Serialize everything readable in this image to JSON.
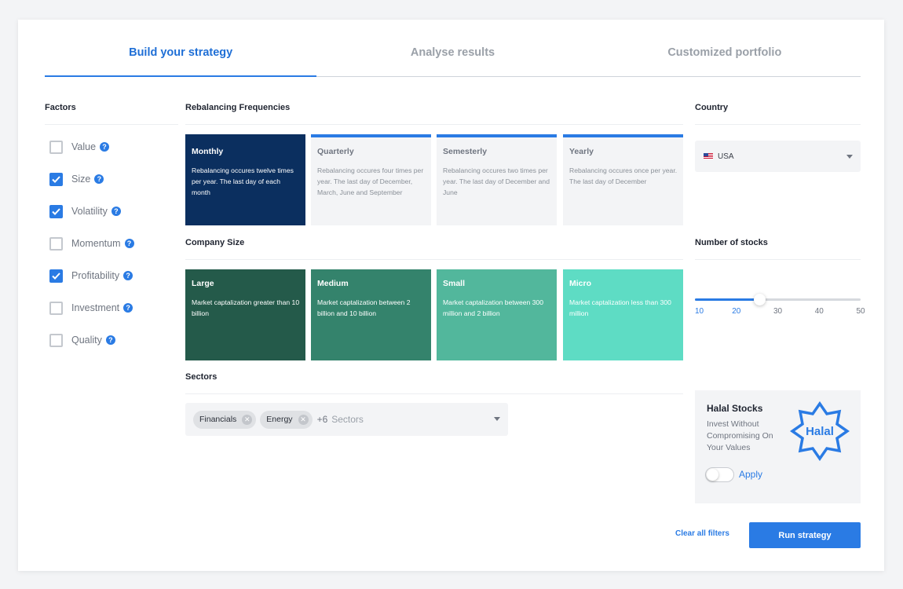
{
  "tabs": [
    {
      "label": "Build your strategy",
      "active": true
    },
    {
      "label": "Analyse results",
      "active": false
    },
    {
      "label": "Customized portfolio",
      "active": false
    }
  ],
  "factors": {
    "title": "Factors",
    "items": [
      {
        "label": "Value",
        "checked": false
      },
      {
        "label": "Size",
        "checked": true
      },
      {
        "label": "Volatility",
        "checked": true
      },
      {
        "label": "Momentum",
        "checked": false
      },
      {
        "label": "Profitability",
        "checked": true
      },
      {
        "label": "Investment",
        "checked": false
      },
      {
        "label": "Quality",
        "checked": false
      }
    ],
    "help_glyph": "?"
  },
  "rebalancing": {
    "title": "Rebalancing Frequencies",
    "options": [
      {
        "title": "Monthly",
        "desc": "Rebalancing occures twelve times per year. The last day of each month",
        "selected": true
      },
      {
        "title": "Quarterly",
        "desc": "Rebalancing occures four times per year. The last day of December, March, June and September",
        "selected": false
      },
      {
        "title": "Semesterly",
        "desc": "Rebalancing occures two times per year. The last day of December and June",
        "selected": false
      },
      {
        "title": "Yearly",
        "desc": "Rebalancing occures once per year. The last day of December",
        "selected": false
      }
    ]
  },
  "company_size": {
    "title": "Company Size",
    "options": [
      {
        "title": "Large",
        "desc": "Market captalization greater than 10 billion",
        "color": "#245a4a"
      },
      {
        "title": "Medium",
        "desc": "Market captalization between 2 billion and 10 billion",
        "color": "#34836c"
      },
      {
        "title": "Small",
        "desc": "Market captalization between 300 million and 2 billion",
        "color": "#52b79c"
      },
      {
        "title": "Micro",
        "desc": "Market captalization less than 300 million",
        "color": "#5edcc4"
      }
    ]
  },
  "sectors": {
    "title": "Sectors",
    "chips": [
      "Financials",
      "Energy"
    ],
    "more_count": "+6",
    "more_label": "Sectors"
  },
  "country": {
    "title": "Country",
    "value": "USA"
  },
  "stocks": {
    "title": "Number of stocks",
    "ticks": [
      "10",
      "20",
      "30",
      "40",
      "50"
    ],
    "value_fraction": 0.39
  },
  "halal": {
    "title": "Halal Stocks",
    "desc": "Invest Without Compromising On Your Values",
    "badge": "Halal",
    "apply_label": "Apply",
    "enabled": false
  },
  "footer": {
    "clear_label": "Clear all filters",
    "run_label": "Run strategy"
  },
  "colors": {
    "accent": "#2a7be4",
    "selected_tile": "#0b2f5f"
  }
}
